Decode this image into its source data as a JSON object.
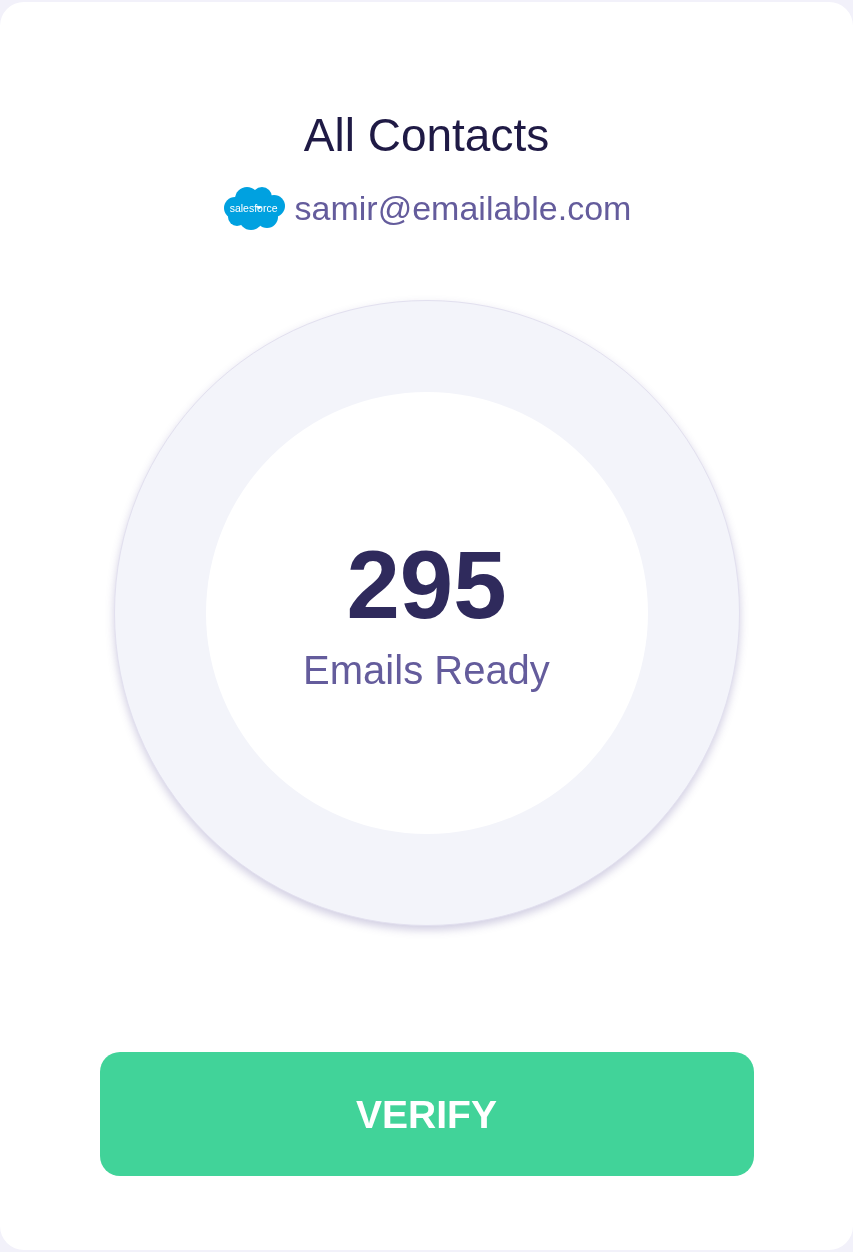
{
  "header": {
    "title": "All Contacts",
    "source": {
      "logo_text": "salesforce",
      "account": "samir@emailable.com"
    }
  },
  "summary": {
    "count": "295",
    "label": "Emails Ready"
  },
  "button": {
    "label": "VERIFY"
  }
}
